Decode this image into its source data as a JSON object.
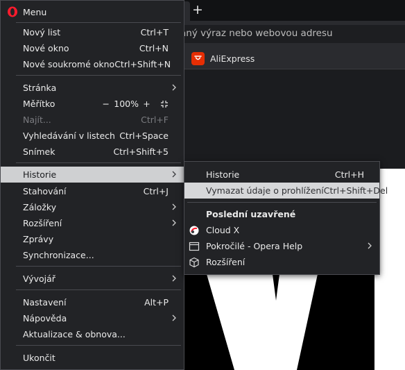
{
  "browser": {
    "address_placeholder": "aný výraz nebo webovou adresu",
    "new_tab_symbol": "+",
    "bookmarks": [
      {
        "label": "AliExpress",
        "icon": "aliexpress-icon"
      }
    ]
  },
  "main_menu": {
    "title": "Menu",
    "items": {
      "new_tab": {
        "label": "Nový list",
        "shortcut": "Ctrl+T"
      },
      "new_window": {
        "label": "Nové okno",
        "shortcut": "Ctrl+N"
      },
      "private_window": {
        "label": "Nové soukromé okno",
        "shortcut": "Ctrl+Shift+N"
      },
      "page": {
        "label": "Stránka"
      },
      "zoom": {
        "label": "Měřítko",
        "minus": "−",
        "value": "100%",
        "plus": "+"
      },
      "find": {
        "label": "Najít...",
        "shortcut": "Ctrl+F"
      },
      "tab_search": {
        "label": "Vyhledávání v listech",
        "shortcut": "Ctrl+Space"
      },
      "snapshot": {
        "label": "Snímek",
        "shortcut": "Ctrl+Shift+5"
      },
      "history": {
        "label": "Historie"
      },
      "downloads": {
        "label": "Stahování",
        "shortcut": "Ctrl+J"
      },
      "bookmarks": {
        "label": "Záložky"
      },
      "extensions": {
        "label": "Rozšíření"
      },
      "news": {
        "label": "Zprávy"
      },
      "sync": {
        "label": "Synchronizace..."
      },
      "developer": {
        "label": "Vývojář"
      },
      "settings": {
        "label": "Nastavení",
        "shortcut": "Alt+P"
      },
      "help": {
        "label": "Nápověda"
      },
      "update": {
        "label": "Aktualizace & obnova..."
      },
      "quit": {
        "label": "Ukončit"
      }
    }
  },
  "history_submenu": {
    "history": {
      "label": "Historie",
      "shortcut": "Ctrl+H"
    },
    "clear_data": {
      "label": "Vymazat údaje o prohlížení",
      "shortcut": "Ctrl+Shift+Del"
    },
    "recently_closed_heading": "Poslední uzavřené",
    "recent": [
      {
        "label": "Cloud X",
        "icon": "cloudx-favicon-icon"
      },
      {
        "label": "Pokročilé - Opera Help",
        "icon": "window-icon"
      },
      {
        "label": "Rozšíření",
        "icon": "extensions-cube-icon"
      }
    ]
  },
  "colors": {
    "menu_bg": "#222326",
    "highlight_bg": "#cfd0d2",
    "hover_bg": "#d6d7d9",
    "disabled_text": "#7b7c80",
    "opera_red": "#ff1b2d",
    "aliexpress_red": "#e62e04"
  }
}
